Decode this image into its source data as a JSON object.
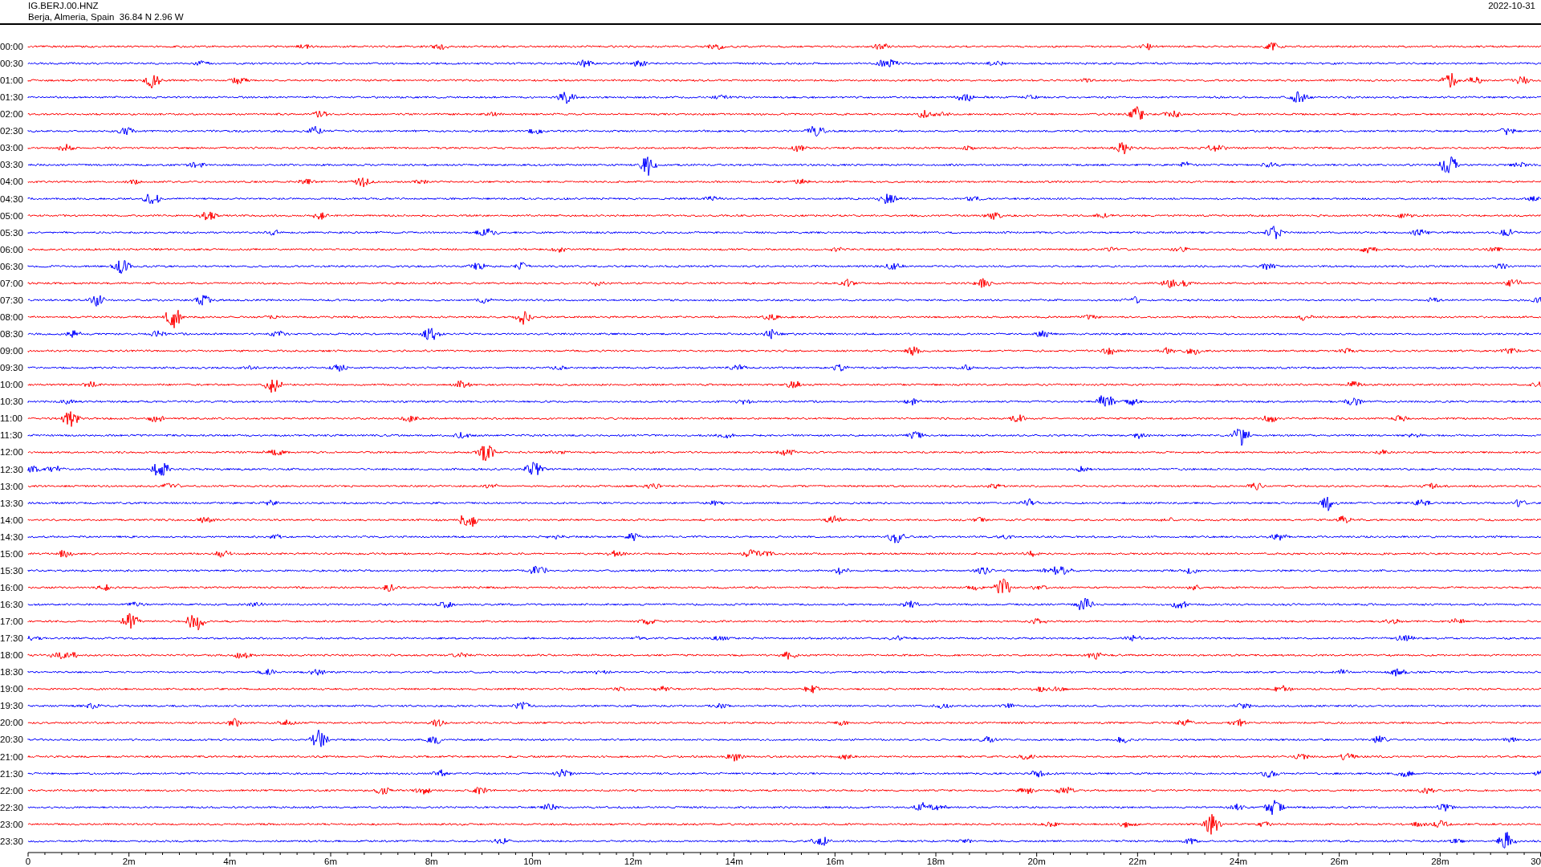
{
  "header": {
    "station": "IG.BERJ.00.HNZ",
    "location": "Berja, Almeria, Spain  36.84 N 2.96 W",
    "date": "2022-10-31"
  },
  "rows": [
    {
      "label": "00:00",
      "color": "#ff0000"
    },
    {
      "label": "00:30",
      "color": "#0000ff"
    },
    {
      "label": "01:00",
      "color": "#ff0000"
    },
    {
      "label": "01:30",
      "color": "#0000ff"
    },
    {
      "label": "02:00",
      "color": "#ff0000"
    },
    {
      "label": "02:30",
      "color": "#0000ff"
    },
    {
      "label": "03:00",
      "color": "#ff0000"
    },
    {
      "label": "03:30",
      "color": "#0000ff"
    },
    {
      "label": "04:00",
      "color": "#ff0000"
    },
    {
      "label": "04:30",
      "color": "#0000ff"
    },
    {
      "label": "05:00",
      "color": "#ff0000"
    },
    {
      "label": "05:30",
      "color": "#0000ff"
    },
    {
      "label": "06:00",
      "color": "#ff0000"
    },
    {
      "label": "06:30",
      "color": "#0000ff"
    },
    {
      "label": "07:00",
      "color": "#ff0000"
    },
    {
      "label": "07:30",
      "color": "#0000ff"
    },
    {
      "label": "08:00",
      "color": "#ff0000"
    },
    {
      "label": "08:30",
      "color": "#0000ff"
    },
    {
      "label": "09:00",
      "color": "#ff0000"
    },
    {
      "label": "09:30",
      "color": "#0000ff"
    },
    {
      "label": "10:00",
      "color": "#ff0000"
    },
    {
      "label": "10:30",
      "color": "#0000ff"
    },
    {
      "label": "11:00",
      "color": "#ff0000"
    },
    {
      "label": "11:30",
      "color": "#0000ff"
    },
    {
      "label": "12:00",
      "color": "#ff0000"
    },
    {
      "label": "12:30",
      "color": "#0000ff"
    },
    {
      "label": "13:00",
      "color": "#ff0000"
    },
    {
      "label": "13:30",
      "color": "#0000ff"
    },
    {
      "label": "14:00",
      "color": "#ff0000"
    },
    {
      "label": "14:30",
      "color": "#0000ff"
    },
    {
      "label": "15:00",
      "color": "#ff0000"
    },
    {
      "label": "15:30",
      "color": "#0000ff"
    },
    {
      "label": "16:00",
      "color": "#ff0000"
    },
    {
      "label": "16:30",
      "color": "#0000ff"
    },
    {
      "label": "17:00",
      "color": "#ff0000"
    },
    {
      "label": "17:30",
      "color": "#0000ff"
    },
    {
      "label": "18:00",
      "color": "#ff0000"
    },
    {
      "label": "18:30",
      "color": "#0000ff"
    },
    {
      "label": "19:00",
      "color": "#ff0000"
    },
    {
      "label": "19:30",
      "color": "#0000ff"
    },
    {
      "label": "20:00",
      "color": "#ff0000"
    },
    {
      "label": "20:30",
      "color": "#0000ff"
    },
    {
      "label": "21:00",
      "color": "#ff0000"
    },
    {
      "label": "21:30",
      "color": "#0000ff"
    },
    {
      "label": "22:00",
      "color": "#ff0000"
    },
    {
      "label": "22:30",
      "color": "#0000ff"
    },
    {
      "label": "23:00",
      "color": "#ff0000"
    },
    {
      "label": "23:30",
      "color": "#0000ff"
    }
  ],
  "x_axis": {
    "ticks": [
      "0",
      "2m",
      "4m",
      "6m",
      "8m",
      "10m",
      "12m",
      "14m",
      "16m",
      "18m",
      "20m",
      "22m",
      "24m",
      "26m",
      "28m",
      "30"
    ]
  }
}
